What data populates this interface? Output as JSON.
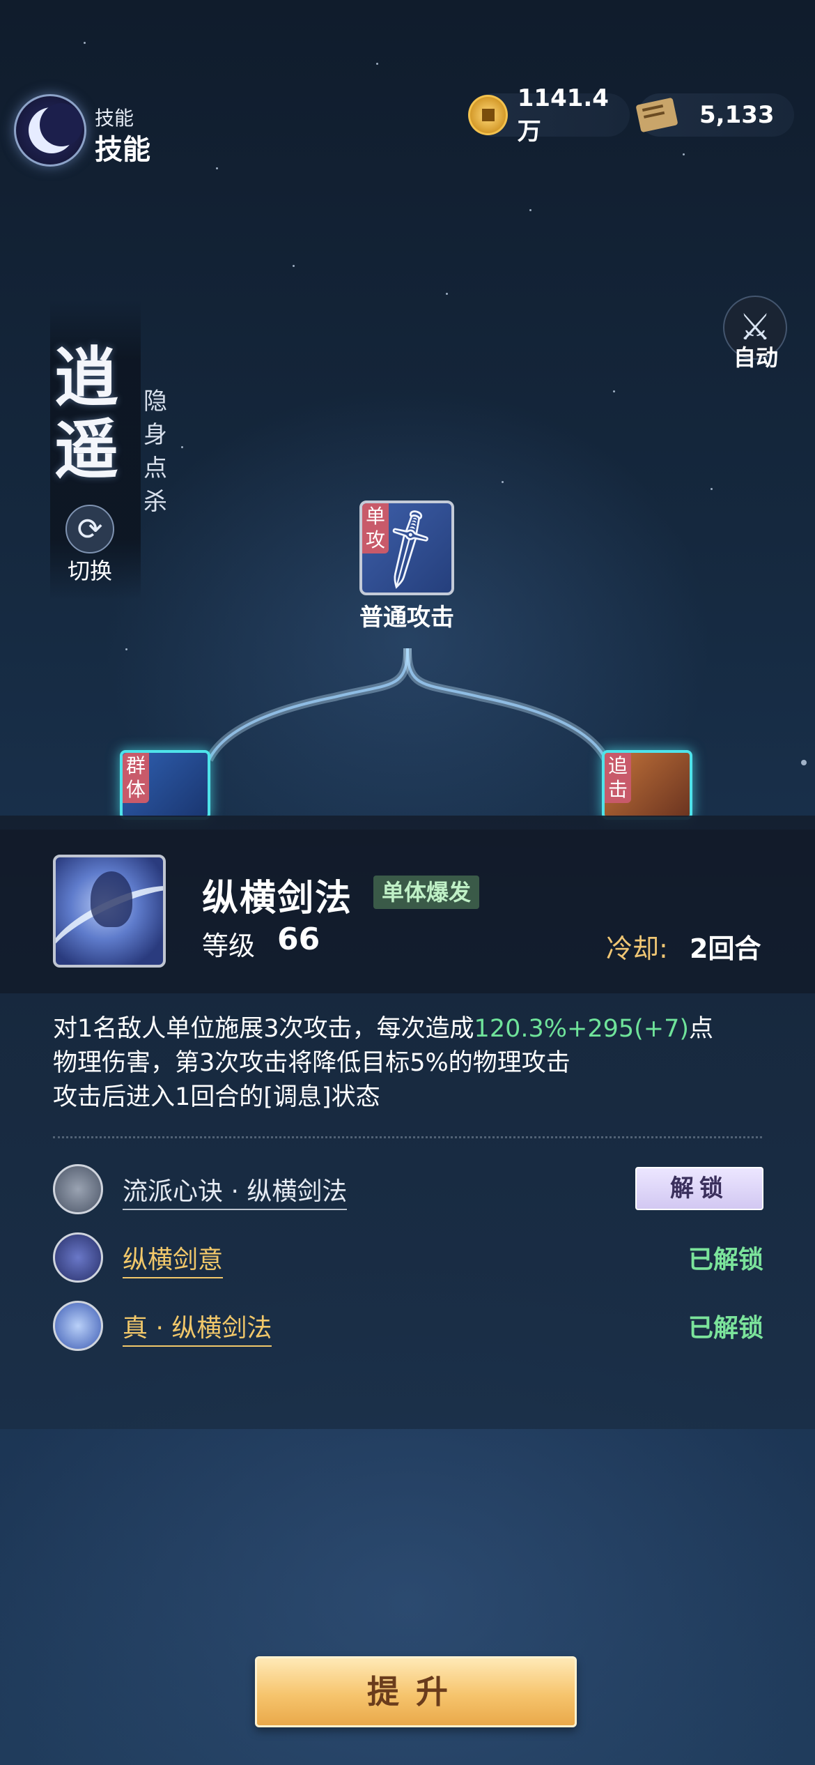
{
  "header": {
    "small_title": "技能",
    "title": "技能"
  },
  "currencies": {
    "coins": "1141.4万",
    "scrolls": "5,133"
  },
  "school": {
    "name": "逍遥",
    "subtitle": "隐身点杀",
    "switch_label": "切换"
  },
  "auto_label": "自动",
  "tree": {
    "root": {
      "tag": "单攻",
      "label": "普通攻击"
    },
    "left": {
      "tag": "群体"
    },
    "right": {
      "tag": "追击"
    }
  },
  "skill": {
    "name": "纵横剑法",
    "type": "单体爆发",
    "level_label": "等级",
    "level": "66",
    "cooldown_label": "冷却:",
    "cooldown": "2回合",
    "desc_1a": "对1名敌人单位施展3次攻击，每次造成",
    "desc_1b": "120.3%+295(+7)",
    "desc_1c": "点",
    "desc_2": "物理伤害，第3次攻击将降低目标5%的物理攻击",
    "desc_3": "攻击后进入1回合的[调息]状态"
  },
  "unlocks": [
    {
      "name": "流派心诀 · 纵横剑法",
      "button": "解锁"
    },
    {
      "name": "纵横剑意",
      "status": "已解锁"
    },
    {
      "name": "真 · 纵横剑法",
      "status": "已解锁"
    }
  ],
  "upgrade_label": "提升",
  "colors": {
    "accent_green": "#7be39b",
    "gold": "#f2c86a",
    "button_gold": "#f6c46d"
  }
}
